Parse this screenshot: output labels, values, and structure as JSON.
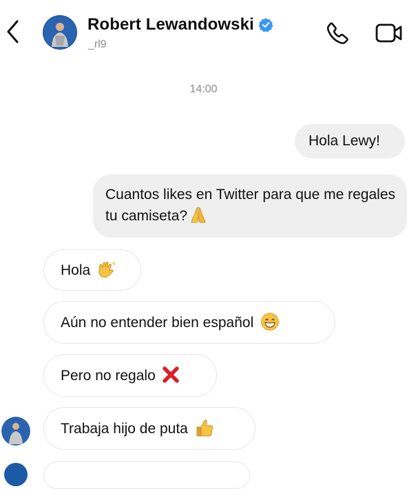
{
  "header": {
    "back_icon": "chevron-left-icon",
    "contact_name": "Robert Lewandowski",
    "verified_icon": "verified-badge-icon",
    "handle": "_rl9",
    "call_icon": "phone-icon",
    "video_icon": "video-camera-icon"
  },
  "thread": {
    "timestamp": "14:00",
    "messages": [
      {
        "direction": "sent",
        "text": "Hola Lewy!"
      },
      {
        "direction": "sent",
        "text": "Cuantos likes en Twitter para que me regales tu camiseta?",
        "emoji": "folded-hands-icon"
      },
      {
        "direction": "received",
        "text": "Hola",
        "emoji": "waving-hand-icon"
      },
      {
        "direction": "received",
        "text": "Aún no entender bien español",
        "emoji": "grinning-sweat-icon"
      },
      {
        "direction": "received",
        "text": "Pero no regalo",
        "emoji": "cross-mark-icon"
      },
      {
        "direction": "received",
        "text": "Trabaja hijo de puta",
        "emoji": "thumbs-up-icon"
      }
    ]
  },
  "colors": {
    "sent_bubble": "#efefef",
    "received_border": "#e6e6e6",
    "verified_blue": "#3897f0",
    "muted_text": "#8e8e8e",
    "cross_red": "#d91f2a",
    "emoji_yellow": "#f6c342"
  }
}
